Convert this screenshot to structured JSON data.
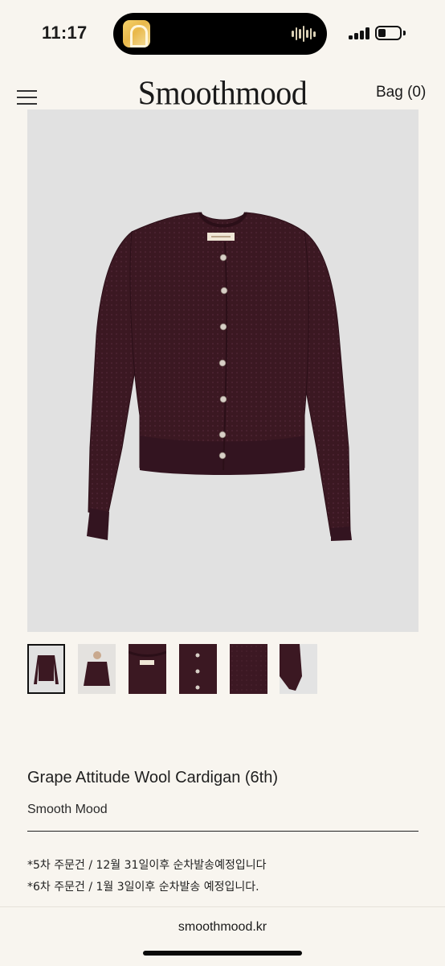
{
  "status_bar": {
    "time": "11:17",
    "island_app_icon": "notes-app-icon",
    "waveform_icon": "audio-waveform-icon",
    "signal_icon": "cellular-signal-icon",
    "battery_icon": "battery-icon",
    "battery_level": 0.35
  },
  "header": {
    "menu_icon": "hamburger-menu-icon",
    "brand": "Smoothmood",
    "bag_label": "Bag (0)"
  },
  "gallery": {
    "main_image_alt": "cardigan-photo",
    "selected_index": 0,
    "thumbnails": [
      {
        "name": "thumb-front-flat",
        "selected": true
      },
      {
        "name": "thumb-worn"
      },
      {
        "name": "thumb-label-detail"
      },
      {
        "name": "thumb-button-detail"
      },
      {
        "name": "thumb-knit-texture"
      },
      {
        "name": "thumb-sleeve-detail"
      }
    ],
    "product_color": "#3b1822",
    "background_color": "#e1e1e1"
  },
  "product": {
    "title": "Grape Attitude Wool Cardigan (6th)",
    "brand": "Smooth Mood",
    "notices": [
      "*5차 주문건 / 12월 31일이후 순차발송예정입니다",
      "*6차 주문건 / 1월 3일이후 순차발송 예정입니다."
    ]
  },
  "browser": {
    "url": "smoothmood.kr"
  }
}
